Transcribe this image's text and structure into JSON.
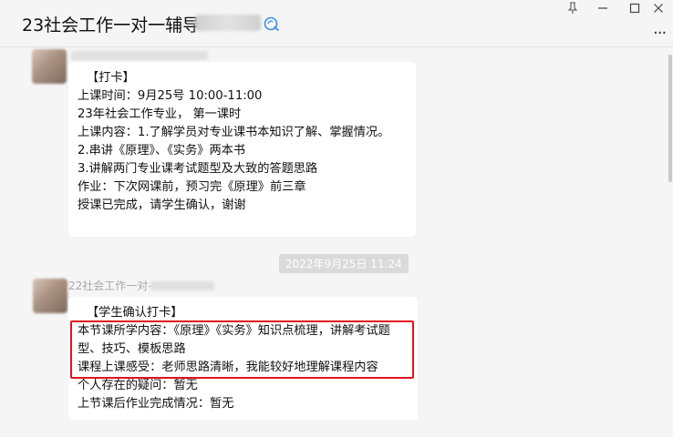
{
  "window": {
    "title": "23社会工作一对一辅导",
    "pin_icon": "pin-icon",
    "minimize_icon": "minimize-icon",
    "maximize_icon": "maximize-icon",
    "close_icon": "close-icon",
    "more_label": "..."
  },
  "messages": [
    {
      "sender": "",
      "lines": [
        "【打卡】",
        "上课时间：9月25号 10:00-11:00",
        "23年社会工作专业， 第一课时",
        "上课内容：1.了解学员对专业课书本知识了解、掌握情况。",
        "2.串讲《原理》、《实务》两本书",
        "3.讲解两门专业课考试题型及大致的答题思路",
        "作业：下次网课前，预习完《原理》前三章",
        "授课已完成，请学生确认，谢谢"
      ]
    },
    {
      "sender": "22社会工作一对-",
      "timestamp": "2022年9月25日 11:24",
      "lines": [
        "【学生确认打卡】",
        "本节课所学内容：《原理》《实务》知识点梳理，讲解考试题型、技巧、模板思路",
        "课程上课感受：老师思路清晰，我能较好地理解课程内容",
        "个人存在的疑问：暂无",
        "上节课后作业完成情况：暂无"
      ]
    }
  ],
  "colors": {
    "highlight": "#e0141e",
    "background": "#f5f5f5",
    "bubble": "#ffffff",
    "timestamp_bg": "#dadada"
  }
}
